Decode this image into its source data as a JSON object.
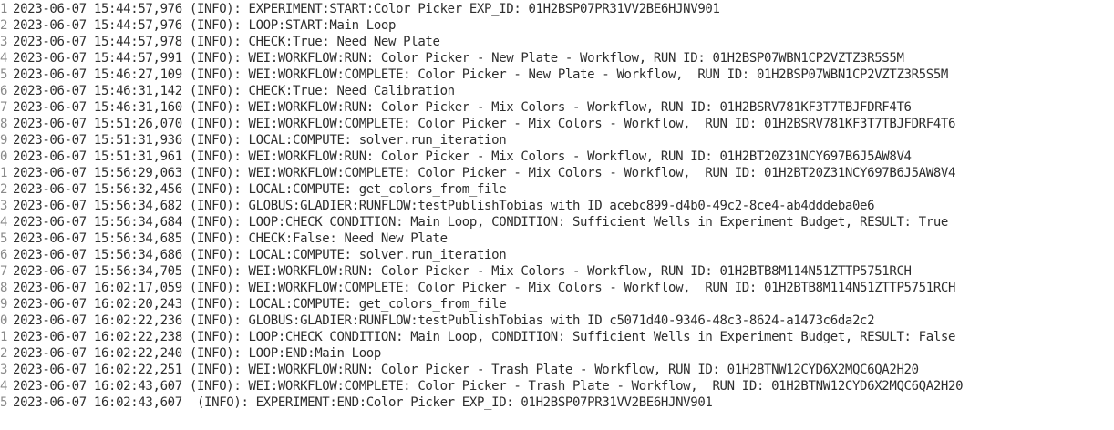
{
  "window": {
    "title": ""
  },
  "log": {
    "lines": [
      {
        "num": "1",
        "text": "2023-06-07 15:44:57,976 (INFO): EXPERIMENT:START:Color Picker EXP_ID: 01H2BSP07PR31VV2BE6HJNV901"
      },
      {
        "num": "2",
        "text": "2023-06-07 15:44:57,976 (INFO): LOOP:START:Main Loop"
      },
      {
        "num": "3",
        "text": "2023-06-07 15:44:57,978 (INFO): CHECK:True: Need New Plate"
      },
      {
        "num": "4",
        "text": "2023-06-07 15:44:57,991 (INFO): WEI:WORKFLOW:RUN: Color Picker - New Plate - Workflow, RUN ID: 01H2BSP07WBN1CP2VZTZ3R5S5M"
      },
      {
        "num": "5",
        "text": "2023-06-07 15:46:27,109 (INFO): WEI:WORKFLOW:COMPLETE: Color Picker - New Plate - Workflow,  RUN ID: 01H2BSP07WBN1CP2VZTZ3R5S5M"
      },
      {
        "num": "6",
        "text": "2023-06-07 15:46:31,142 (INFO): CHECK:True: Need Calibration"
      },
      {
        "num": "7",
        "text": "2023-06-07 15:46:31,160 (INFO): WEI:WORKFLOW:RUN: Color Picker - Mix Colors - Workflow, RUN ID: 01H2BSRV781KF3T7TBJFDRF4T6"
      },
      {
        "num": "8",
        "text": "2023-06-07 15:51:26,070 (INFO): WEI:WORKFLOW:COMPLETE: Color Picker - Mix Colors - Workflow,  RUN ID: 01H2BSRV781KF3T7TBJFDRF4T6"
      },
      {
        "num": "9",
        "text": "2023-06-07 15:51:31,936 (INFO): LOCAL:COMPUTE: solver.run_iteration"
      },
      {
        "num": "0",
        "text": "2023-06-07 15:51:31,961 (INFO): WEI:WORKFLOW:RUN: Color Picker - Mix Colors - Workflow, RUN ID: 01H2BT20Z31NCY697B6J5AW8V4"
      },
      {
        "num": "1",
        "text": "2023-06-07 15:56:29,063 (INFO): WEI:WORKFLOW:COMPLETE: Color Picker - Mix Colors - Workflow,  RUN ID: 01H2BT20Z31NCY697B6J5AW8V4"
      },
      {
        "num": "2",
        "text": "2023-06-07 15:56:32,456 (INFO): LOCAL:COMPUTE: get_colors_from_file"
      },
      {
        "num": "3",
        "text": "2023-06-07 15:56:34,682 (INFO): GLOBUS:GLADIER:RUNFLOW:testPublishTobias with ID acebc899-d4b0-49c2-8ce4-ab4dddeba0e6"
      },
      {
        "num": "4",
        "text": "2023-06-07 15:56:34,684 (INFO): LOOP:CHECK CONDITION: Main Loop, CONDITION: Sufficient Wells in Experiment Budget, RESULT: True"
      },
      {
        "num": "5",
        "text": "2023-06-07 15:56:34,685 (INFO): CHECK:False: Need New Plate"
      },
      {
        "num": "6",
        "text": "2023-06-07 15:56:34,686 (INFO): LOCAL:COMPUTE: solver.run_iteration"
      },
      {
        "num": "7",
        "text": "2023-06-07 15:56:34,705 (INFO): WEI:WORKFLOW:RUN: Color Picker - Mix Colors - Workflow, RUN ID: 01H2BTB8M114N51ZTTP5751RCH"
      },
      {
        "num": "8",
        "text": "2023-06-07 16:02:17,059 (INFO): WEI:WORKFLOW:COMPLETE: Color Picker - Mix Colors - Workflow,  RUN ID: 01H2BTB8M114N51ZTTP5751RCH"
      },
      {
        "num": "9",
        "text": "2023-06-07 16:02:20,243 (INFO): LOCAL:COMPUTE: get_colors_from_file"
      },
      {
        "num": "0",
        "text": "2023-06-07 16:02:22,236 (INFO): GLOBUS:GLADIER:RUNFLOW:testPublishTobias with ID c5071d40-9346-48c3-8624-a1473c6da2c2"
      },
      {
        "num": "1",
        "text": "2023-06-07 16:02:22,238 (INFO): LOOP:CHECK CONDITION: Main Loop, CONDITION: Sufficient Wells in Experiment Budget, RESULT: False"
      },
      {
        "num": "2",
        "text": "2023-06-07 16:02:22,240 (INFO): LOOP:END:Main Loop"
      },
      {
        "num": "3",
        "text": "2023-06-07 16:02:22,251 (INFO): WEI:WORKFLOW:RUN: Color Picker - Trash Plate - Workflow, RUN ID: 01H2BTNW12CYD6X2MQC6QA2H20"
      },
      {
        "num": "4",
        "text": "2023-06-07 16:02:43,607 (INFO): WEI:WORKFLOW:COMPLETE: Color Picker - Trash Plate - Workflow,  RUN ID: 01H2BTNW12CYD6X2MQC6QA2H20"
      },
      {
        "num": "5",
        "text": "2023-06-07 16:02:43,607  (INFO): EXPERIMENT:END:Color Picker EXP_ID: 01H2BSP07PR31VV2BE6HJNV901"
      }
    ]
  },
  "colors": {
    "background": "#ffffff",
    "text": "#2e2e2e",
    "gutter": "#8a8a8a"
  }
}
